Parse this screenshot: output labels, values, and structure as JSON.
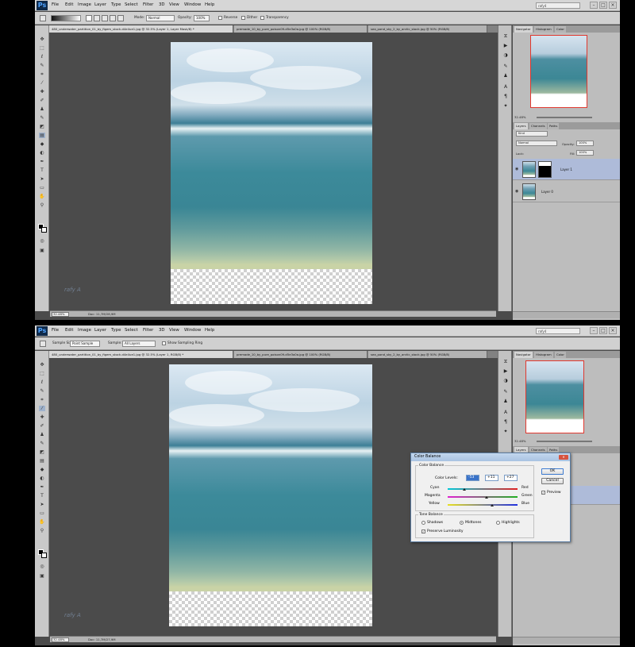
{
  "shot1": {
    "menu": [
      "File",
      "Edit",
      "Image",
      "Layer",
      "Type",
      "Select",
      "Filter",
      "3D",
      "View",
      "Window",
      "Help"
    ],
    "workspace": "rafy4",
    "options": {
      "mode_label": "Mode:",
      "mode_value": "Normal",
      "opacity_label": "Opacity:",
      "opacity_value": "100%",
      "reverse": "Reverse",
      "dither": "Dither",
      "transparency": "Transparency"
    },
    "tabs": [
      "480_underwater_partition_01_by_figem_stock-d4e4ue1.jpg @ 32.5% (Layer 1, Layer Mask/8) *",
      "premade_10_by_pure_poison09-d5e3o0a.jpg @ 100% (RGB/8)",
      "sea_pond_sky_2_by_arctic_stock.jpg @ 50% (RGB/8)"
    ],
    "status": {
      "zoom": "32.48%",
      "doc": "Doc: 11,7M/28,9M"
    },
    "panels": {
      "nav_tabs": [
        "Navigator",
        "Histogram",
        "Color"
      ],
      "nav_zoom": "32.48%",
      "layer_tabs": [
        "Layers",
        "Channels",
        "Paths"
      ],
      "kind": "Kind",
      "blend": "Normal",
      "opacity_label": "Opacity:",
      "opacity_value": "100%",
      "lock_label": "Lock:",
      "fill_label": "Fill:",
      "fill_value": "100%",
      "layers": [
        "Layer 1",
        "Layer 0"
      ]
    }
  },
  "shot2": {
    "menu": [
      "File",
      "Edit",
      "Image",
      "Layer",
      "Type",
      "Select",
      "Filter",
      "3D",
      "View",
      "Window",
      "Help"
    ],
    "workspace": "rafy4",
    "options": {
      "sample_size_label": "Sample Size:",
      "sample_size_value": "Point Sample",
      "sample_label": "Sample:",
      "sample_value": "All Layers",
      "show_ring": "Show Sampling Ring"
    },
    "tabs": [
      "480_underwater_partition_01_by_figem_stock-d4e4ue1.jpg @ 32.5% (Layer 1, RGB/8) *",
      "premade_10_by_pure_poison09-d5e3o0a.jpg @ 100% (RGB/8)",
      "sea_pond_sky_2_by_arctic_stock.jpg @ 50% (RGB/8)"
    ],
    "status": {
      "zoom": "32.48%",
      "doc": "Doc: 11,7M/27,9M"
    },
    "panels": {
      "nav_tabs": [
        "Navigator",
        "Histogram",
        "Color"
      ],
      "nav_zoom": "32.48%",
      "layer_tabs": [
        "Layers",
        "Channels",
        "Paths"
      ]
    },
    "dialog": {
      "title": "Color Balance",
      "color_balance_group": "Color Balance",
      "color_levels_label": "Color Levels:",
      "levels": [
        "-53",
        "+11",
        "+27"
      ],
      "sliders": [
        {
          "left": "Cyan",
          "right": "Red",
          "value": -53
        },
        {
          "left": "Magenta",
          "right": "Green",
          "value": 11
        },
        {
          "left": "Yellow",
          "right": "Blue",
          "value": 27
        }
      ],
      "tone_group": "Tone Balance",
      "tones": [
        "Shadows",
        "Midtones",
        "Highlights"
      ],
      "selected_tone": "Midtones",
      "preserve": "Preserve Luminosity",
      "ok": "OK",
      "cancel": "Cancel",
      "preview": "Preview"
    }
  },
  "watermark": "rafy A",
  "colors": {
    "accent": "#3a73c9",
    "nav_frame": "#e0382f",
    "dialog_title": "#a9c3e2"
  }
}
